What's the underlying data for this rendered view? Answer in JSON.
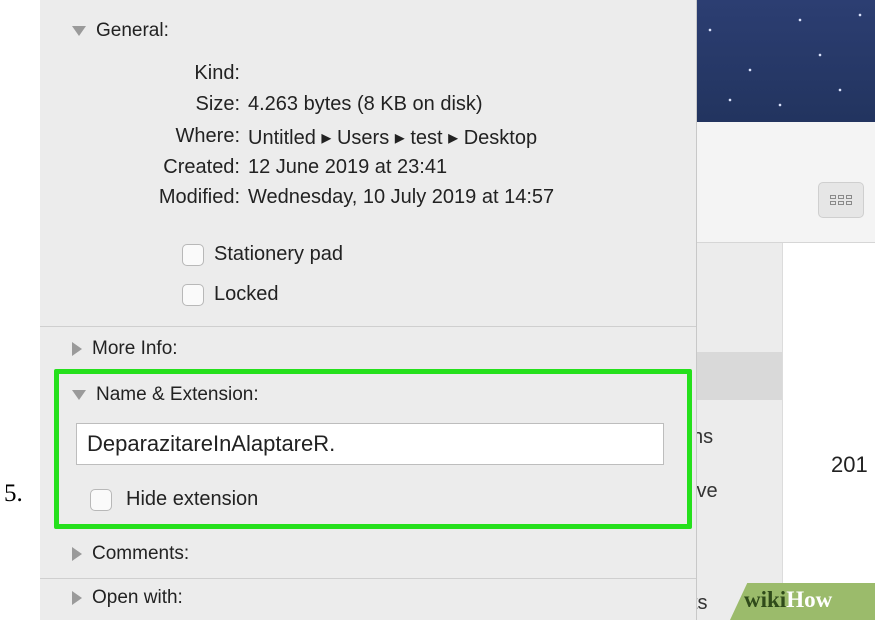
{
  "step_label": "5.",
  "general": {
    "header": "General:",
    "rows": [
      {
        "key": "Kind:",
        "value": ""
      },
      {
        "key": "Size:",
        "value": "4.263 bytes (8 KB on disk)"
      },
      {
        "key": "Where:",
        "value": "Untitled ▸ Users ▸ test ▸ Desktop"
      },
      {
        "key": "Created:",
        "value": "12 June 2019 at 23:41"
      },
      {
        "key": "Modified:",
        "value": "Wednesday, 10 July 2019 at 14:57"
      }
    ],
    "stationery_label": "Stationery pad",
    "locked_label": "Locked"
  },
  "more_info": {
    "header": "More Info:"
  },
  "name_extension": {
    "header": "Name & Extension:",
    "filename_value": "DeparazitareInAlaptareR.",
    "hide_extension_label": "Hide extension"
  },
  "comments": {
    "header": "Comments:"
  },
  "open_with": {
    "header": "Open with:"
  },
  "background_window": {
    "fragment_ns": "ns",
    "fragment_ive": "ive",
    "fragment_ts": "ts",
    "fragment_year": "201"
  },
  "watermark": {
    "wiki": "wiki",
    "how": "How"
  },
  "colors": {
    "highlight": "#25e01c",
    "panel_bg": "#ececec"
  },
  "icons": {
    "expanded": "disclosure-triangle-down",
    "collapsed": "disclosure-triangle-right",
    "view": "icon-view-grid"
  }
}
